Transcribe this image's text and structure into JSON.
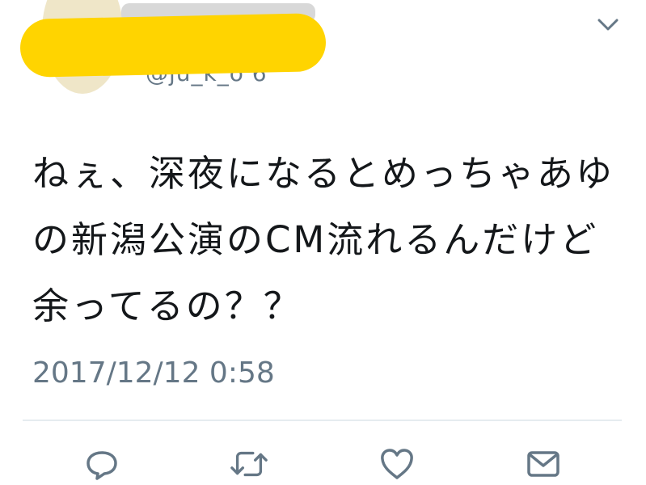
{
  "tweet": {
    "handle_fragment": "@ju_k_o 6",
    "text": "ねぇ、深夜になるとめっちゃあゆの新潟公演のCM流れるんだけど余ってるの？？",
    "timestamp": "2017/12/12 0:58",
    "icons": {
      "menu": "chevron-down-icon",
      "reply": "reply-icon",
      "retweet": "retweet-icon",
      "like": "heart-icon",
      "message": "message-icon"
    },
    "colors": {
      "text": "#14171a",
      "meta": "#657786",
      "redaction": "#ffd400",
      "divider": "#e6ecf0"
    }
  }
}
